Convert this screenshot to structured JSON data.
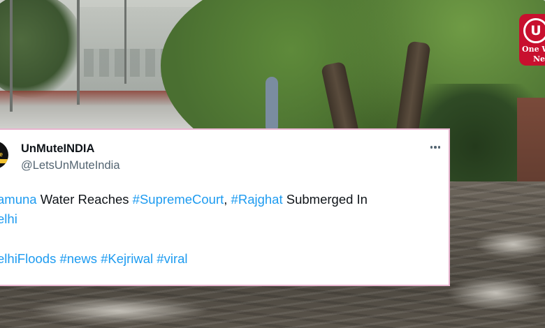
{
  "brand": {
    "mark": "U",
    "line1": "One W",
    "line2": "Ne",
    "color": "#c8102e"
  },
  "tweet": {
    "avatar_text": "te\nA",
    "author_name": "UnMuteINDIA",
    "author_handle": "@LetsUnMuteIndia",
    "more_icon": "more-horizontal-icon",
    "line1": {
      "t1": "amuna",
      "t2": " Water Reaches ",
      "t3": "#SupremeCourt",
      "t4": ", ",
      "t5": "#Rajghat",
      "t6": " Submerged In"
    },
    "line2": {
      "t1": "elhi"
    },
    "line3": {
      "t1": "elhiFloods",
      "t2": " ",
      "t3": "#news",
      "t4": " ",
      "t5": "#Kejriwal",
      "t6": " ",
      "t7": "#viral"
    },
    "hashtag_color": "#1d9bf0",
    "border_color": "#e8b4cf"
  }
}
